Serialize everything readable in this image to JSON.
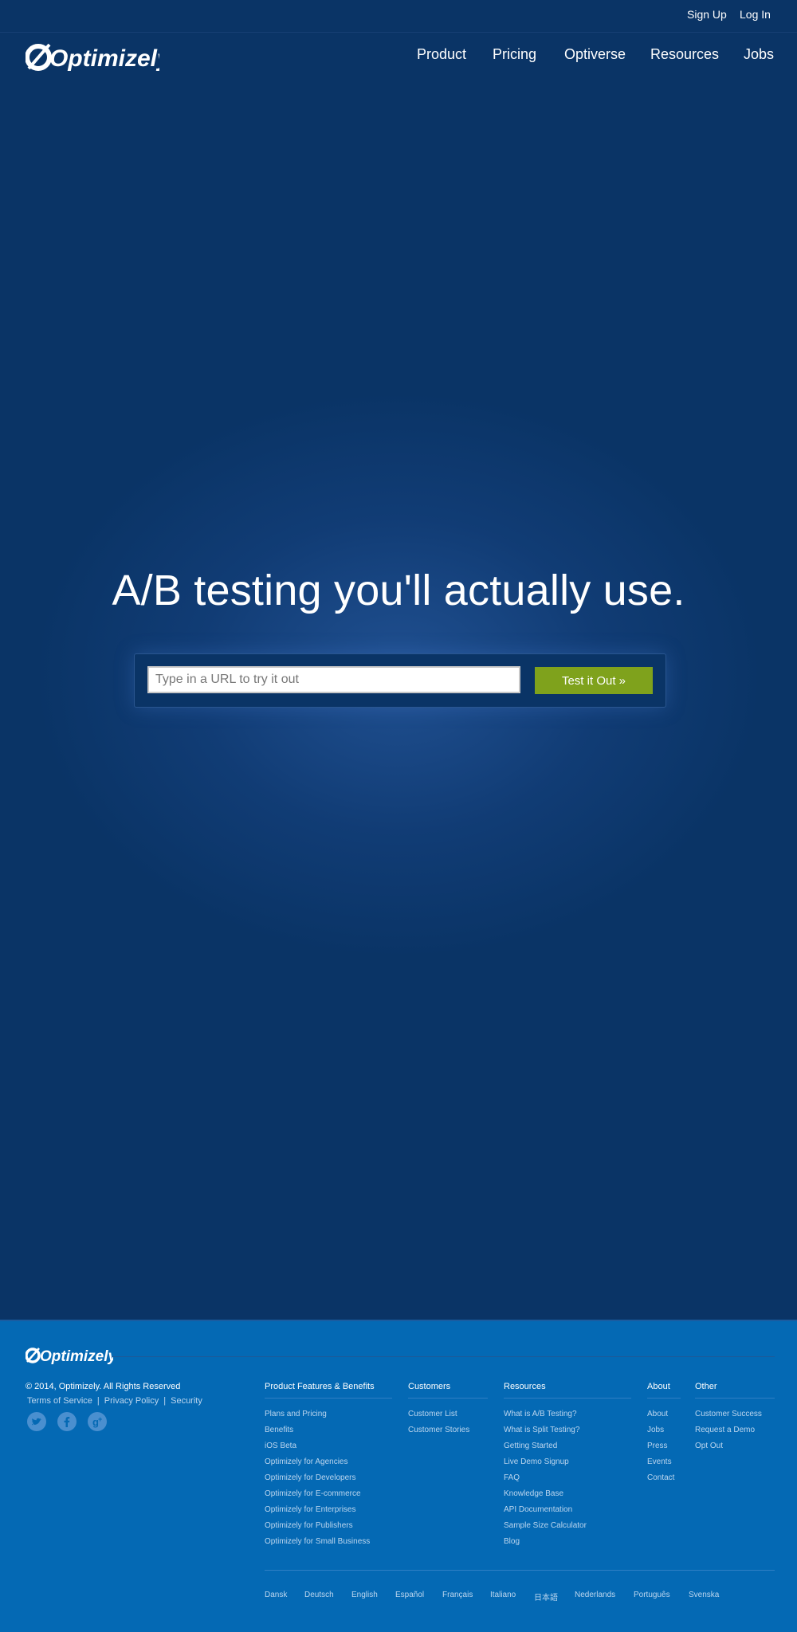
{
  "topbar": {
    "sign_up": "Sign Up",
    "log_in": "Log In"
  },
  "brand": {
    "logo_text": "Optimizely"
  },
  "nav": [
    "Product",
    "Pricing",
    "Optiverse",
    "Resources",
    "Jobs"
  ],
  "hero": {
    "headline": "A/B testing you'll actually use.",
    "url_placeholder": "Type in a URL to try it out",
    "cta": "Test it Out »"
  },
  "footer": {
    "copyright": "© 2014, Optimizely. All Rights Reserved",
    "legal": [
      "Terms of Service",
      "Privacy Policy",
      "Security"
    ],
    "social": [
      "twitter-icon",
      "facebook-icon",
      "google-plus-icon"
    ],
    "columns": [
      {
        "heading": "Product Features & Benefits",
        "links": [
          "Plans and Pricing",
          "Benefits",
          "iOS Beta",
          "Optimizely for Agencies",
          "Optimizely for Developers",
          "Optimizely for E-commerce",
          "Optimizely for Enterprises",
          "Optimizely for Publishers",
          "Optimizely for Small Business"
        ]
      },
      {
        "heading": "Customers",
        "links": [
          "Customer List",
          "Customer Stories"
        ]
      },
      {
        "heading": "Resources",
        "links": [
          "What is A/B Testing?",
          "What is Split Testing?",
          "Getting Started",
          "Live Demo Signup",
          "FAQ",
          "Knowledge Base",
          "API Documentation",
          "Sample Size Calculator",
          "Blog"
        ]
      },
      {
        "heading": "About",
        "links": [
          "About",
          "Jobs",
          "Press",
          "Events",
          "Contact"
        ]
      },
      {
        "heading": "Other",
        "links": [
          "Customer Success",
          "Request a Demo",
          "Opt Out"
        ]
      }
    ],
    "languages": [
      "Dansk",
      "Deutsch",
      "English",
      "Español",
      "Français",
      "Italiano",
      "日本語",
      "Nederlands",
      "Português",
      "Svenska"
    ]
  },
  "colors": {
    "hero_bg": "#0a3466",
    "footer_bg": "#0469b4",
    "cta_bg": "#7fa21c"
  }
}
